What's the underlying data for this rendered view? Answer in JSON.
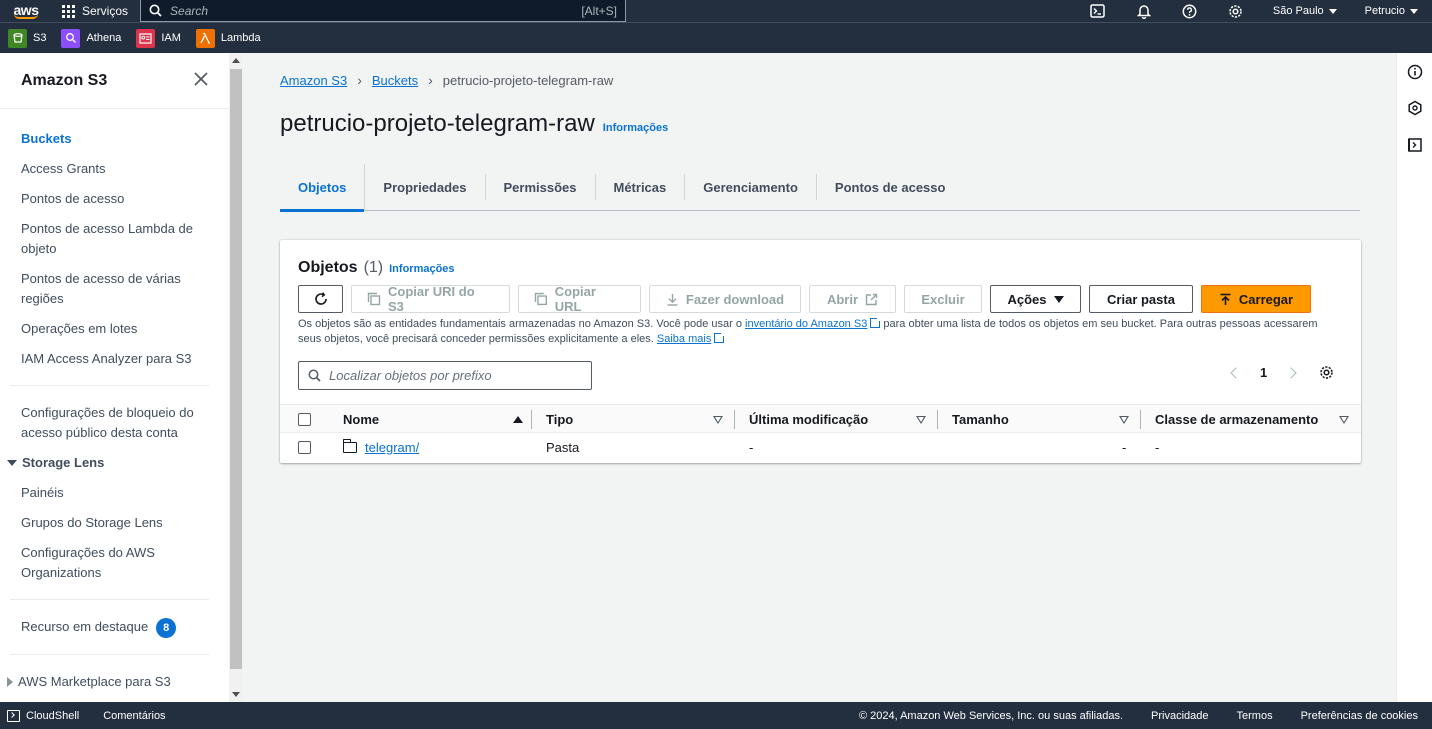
{
  "topnav": {
    "logo": "aws",
    "services_label": "Serviços",
    "search_placeholder": "Search",
    "search_shortcut": "[Alt+S]",
    "region": "São Paulo",
    "user": "Petrucio"
  },
  "favorites": [
    {
      "label": "S3",
      "icon": "s3-icon",
      "color": "#3f8624"
    },
    {
      "label": "Athena",
      "icon": "athena-icon",
      "color": "#8c4fff"
    },
    {
      "label": "IAM",
      "icon": "iam-icon",
      "color": "#dd344c"
    },
    {
      "label": "Lambda",
      "icon": "lambda-icon",
      "color": "#ed7100"
    }
  ],
  "sidebar": {
    "title": "Amazon S3",
    "items": [
      {
        "label": "Buckets",
        "active": true
      },
      {
        "label": "Access Grants"
      },
      {
        "label": "Pontos de acesso"
      },
      {
        "label": "Pontos de acesso Lambda de objeto"
      },
      {
        "label": "Pontos de acesso de várias regiões"
      },
      {
        "label": "Operações em lotes"
      },
      {
        "label": "IAM Access Analyzer para S3"
      }
    ],
    "block_public": "Configurações de bloqueio do acesso público desta conta",
    "storage_lens": {
      "title": "Storage Lens",
      "items": [
        "Painéis",
        "Grupos do Storage Lens",
        "Configurações do AWS Organizations"
      ]
    },
    "featured": {
      "label": "Recurso em destaque",
      "count": "8"
    },
    "marketplace": "AWS Marketplace para S3"
  },
  "breadcrumb": {
    "items": [
      "Amazon S3",
      "Buckets"
    ],
    "current": "petrucio-projeto-telegram-raw"
  },
  "page": {
    "title": "petrucio-projeto-telegram-raw",
    "info": "Informações"
  },
  "tabs": [
    "Objetos",
    "Propriedades",
    "Permissões",
    "Métricas",
    "Gerenciamento",
    "Pontos de acesso"
  ],
  "objects": {
    "title": "Objetos",
    "count": "(1)",
    "info": "Informações",
    "buttons": {
      "copy_uri": "Copiar URI do S3",
      "copy_url": "Copiar URL",
      "download": "Fazer download",
      "open": "Abrir",
      "delete": "Excluir",
      "actions": "Ações",
      "create_folder": "Criar pasta",
      "upload": "Carregar"
    },
    "desc_1": "Os objetos são as entidades fundamentais armazenadas no Amazon S3. Você pode usar o ",
    "desc_link": "inventário do Amazon S3",
    "desc_2": " para obter uma lista de todos os objetos em seu bucket. Para outras pessoas acessarem seus objetos, você precisará conceder permissões explicitamente a eles. ",
    "desc_more": "Saiba mais",
    "filter_placeholder": "Localizar objetos por prefixo",
    "page": "1",
    "columns": [
      "Nome",
      "Tipo",
      "Última modificação",
      "Tamanho",
      "Classe de armazenamento"
    ],
    "rows": [
      {
        "name": "telegram/",
        "type": "Pasta",
        "modified": "-",
        "size": "-",
        "class": "-"
      }
    ]
  },
  "footer": {
    "cloudshell": "CloudShell",
    "feedback": "Comentários",
    "copyright": "© 2024, Amazon Web Services, Inc. ou suas afiliadas.",
    "privacy": "Privacidade",
    "terms": "Termos",
    "cookies": "Preferências de cookies"
  },
  "colors": {
    "nav_bg": "#232f3e",
    "link": "#0972d3",
    "primary": "#ff9900"
  }
}
